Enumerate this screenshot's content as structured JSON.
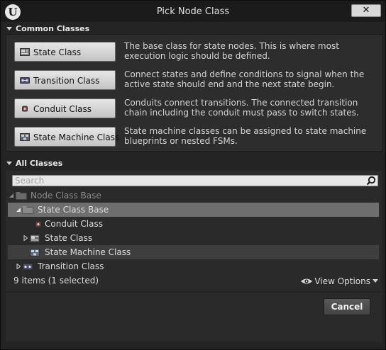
{
  "window": {
    "title": "Pick Node Class",
    "close_label": "✕"
  },
  "common": {
    "header": "Common Classes",
    "items": [
      {
        "label": "State Class",
        "description": "The base class for state nodes. This is where most execution logic should be defined."
      },
      {
        "label": "Transition Class",
        "description": "Connect states and define conditions to signal when the active state should end and the next state begin."
      },
      {
        "label": "Conduit Class",
        "description": "Conduits connect transitions. The connected transition chain including the conduit must pass to switch states."
      },
      {
        "label": "State Machine Class",
        "description": "State machine classes can be assigned to state machine blueprints or nested FSMs."
      }
    ]
  },
  "all": {
    "header": "All Classes",
    "search_placeholder": "Search",
    "tree": [
      {
        "label": "Node Class Base"
      },
      {
        "label": "State Class Base"
      },
      {
        "label": "Conduit Class"
      },
      {
        "label": "State Class"
      },
      {
        "label": "State Machine Class"
      },
      {
        "label": "Transition Class"
      }
    ],
    "status": "9 items (1 selected)",
    "view_options": "View Options"
  },
  "footer": {
    "cancel_label": "Cancel"
  },
  "colors": {
    "accent_selected": "#6e6e6e",
    "hover_row": "#3e3e3e"
  }
}
